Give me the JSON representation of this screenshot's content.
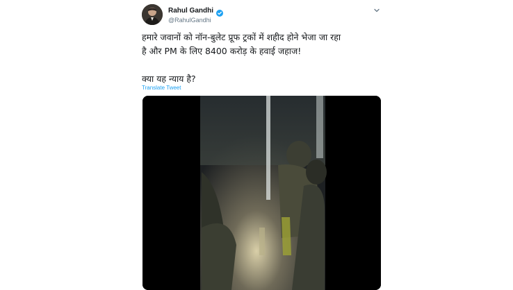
{
  "tweet": {
    "author_name": "Rahul Gandhi",
    "author_handle": "@RahulGandhi",
    "verified_icon": "verified-badge-icon",
    "more_icon": "chevron-down-icon",
    "text_lines": [
      "हमारे जवानों को नॉन-बुलेट प्रूफ ट्रकों में शहीद होने भेजा जा रहा",
      "है और PM के लिए 8400 करोड़ के हवाई जहाज!"
    ],
    "text_question": "क्या यह न्याय है?",
    "translate_label": "Translate Tweet",
    "accent_color": "#1da1f2"
  },
  "media": {
    "type": "video",
    "background_color": "#000000"
  }
}
